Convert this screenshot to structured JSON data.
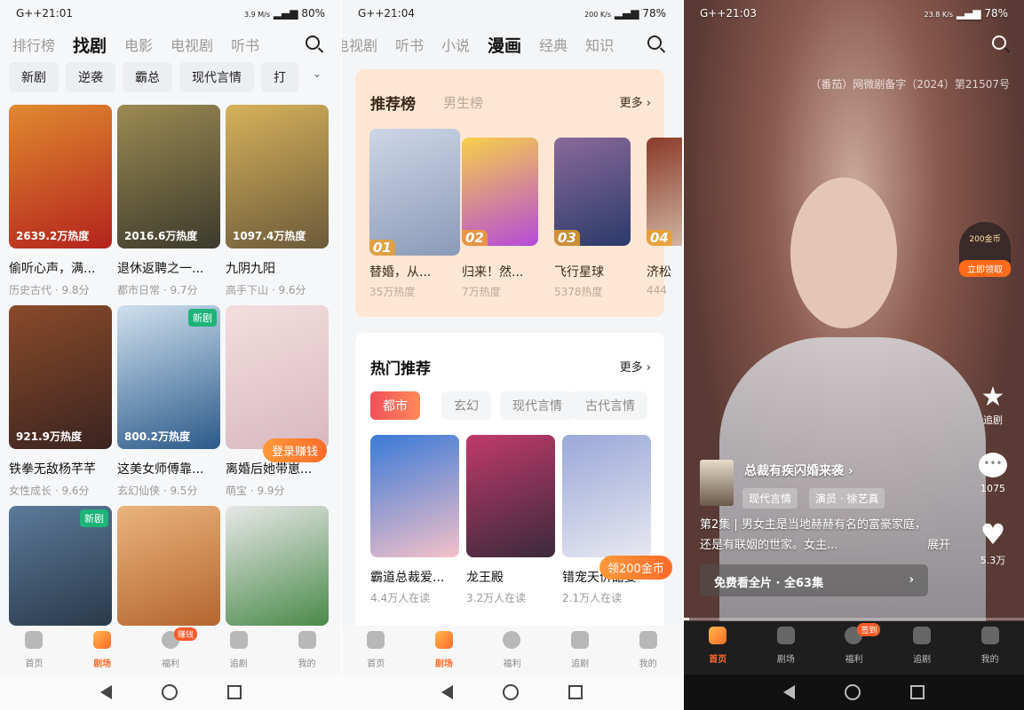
{
  "panel1": {
    "status": {
      "left": "G++21:01",
      "speed": "3.9 M/s",
      "battery": "80%"
    },
    "tabs": [
      "排行榜",
      "找剧",
      "电影",
      "电视剧",
      "听书"
    ],
    "active_tab": "找剧",
    "chips": [
      "新剧",
      "逆袭",
      "霸总",
      "现代言情",
      "打"
    ],
    "cards": [
      {
        "title": "偷听心声，满...",
        "meta": "历史古代 · 9.8分",
        "heat": "2639.2万热度",
        "colors": [
          "#b3231d",
          "#e0892f"
        ]
      },
      {
        "title": "退休返聘之一...",
        "meta": "都市日常 · 9.7分",
        "heat": "2016.6万热度",
        "colors": [
          "#3b3a2c",
          "#9c8a52"
        ]
      },
      {
        "title": "九阴九阳",
        "meta": "高手下山 · 9.6分",
        "heat": "1097.4万热度",
        "colors": [
          "#6b5a3a",
          "#d6b25a"
        ]
      },
      {
        "title": "铁拳无敌杨芊芊",
        "meta": "女性成长 · 9.6分",
        "heat": "921.9万热度",
        "colors": [
          "#3a2420",
          "#8a4a2a"
        ]
      },
      {
        "title": "这美女师傅靠...",
        "meta": "玄幻仙侠 · 9.5分",
        "heat": "800.2万热度",
        "new": "新剧",
        "colors": [
          "#2b5a8a",
          "#cfe0ee"
        ]
      },
      {
        "title": "离婚后她带崽...",
        "meta": "萌宝 · 9.9分",
        "heat": "",
        "colors": [
          "#d8b8c0",
          "#f3dede"
        ]
      },
      {
        "title": "",
        "meta": "",
        "heat": "",
        "new": "新剧",
        "colors": [
          "#2a3a4a",
          "#5c7a9a"
        ]
      },
      {
        "title": "",
        "meta": "",
        "heat": "",
        "colors": [
          "#b5652e",
          "#e9b47c"
        ]
      },
      {
        "title": "",
        "meta": "",
        "heat": "",
        "colors": [
          "#4a8a4a",
          "#e8e8e8"
        ]
      }
    ],
    "float_badge": "登录赚钱",
    "nav": [
      {
        "label": "首页"
      },
      {
        "label": "剧场",
        "active": true
      },
      {
        "label": "福利",
        "badge": "赚钱"
      },
      {
        "label": "追剧"
      },
      {
        "label": "我的"
      }
    ]
  },
  "panel2": {
    "status": {
      "left": "G++21:04",
      "speed": "200 K/s",
      "battery": "78%"
    },
    "tabs": [
      "电视剧",
      "听书",
      "小说",
      "漫画",
      "经典",
      "知识"
    ],
    "active_tab": "漫画",
    "rank_card": {
      "tabs": [
        "推荐榜",
        "男生榜"
      ],
      "more": "更多 ›",
      "items": [
        {
          "rank": "01",
          "title": "替婚，从...",
          "heat": "35万热度",
          "colors": [
            "#cdd6e6",
            "#8a9ab8"
          ]
        },
        {
          "rank": "02",
          "title": "归来！然...",
          "heat": "7万热度",
          "colors": [
            "#f7d04a",
            "#b54ad8"
          ]
        },
        {
          "rank": "03",
          "title": "飞行星球",
          "heat": "5378热度",
          "colors": [
            "#8a6a9a",
            "#2a3a6a"
          ]
        },
        {
          "rank": "04",
          "title": "济松",
          "heat": "444",
          "colors": [
            "#8a3a2a",
            "#d9c3b0"
          ]
        }
      ]
    },
    "hot": {
      "title": "热门推荐",
      "more": "更多 ›",
      "chips": [
        "都市",
        "玄幻",
        "现代言情",
        "古代言情"
      ],
      "items": [
        {
          "title": "霸道总裁爱...",
          "readers": "4.4万人在读",
          "colors": [
            "#3a7ad8",
            "#f3c0c8"
          ]
        },
        {
          "title": "龙王殿",
          "readers": "3.2万人在读",
          "colors": [
            "#c03a6a",
            "#3a2a3a"
          ]
        },
        {
          "title": "错宠天价甜妻",
          "readers": "2.1万人在读",
          "colors": [
            "#9aa8d8",
            "#e8e8f0"
          ]
        }
      ]
    },
    "float_badge": "领200金币",
    "nav": [
      {
        "label": "首页"
      },
      {
        "label": "剧场",
        "active": true
      },
      {
        "label": "福利"
      },
      {
        "label": "追剧"
      },
      {
        "label": "我的"
      }
    ]
  },
  "panel3": {
    "status": {
      "left": "G++21:03",
      "speed": "23.8 K/s",
      "battery": "78%"
    },
    "license": "（番茄）网微剧备字（2024）第21507号",
    "reward": {
      "coins": "200金币",
      "action": "立即领取"
    },
    "actions": {
      "follow": "追剧",
      "comments": "1075",
      "likes": "5.3万"
    },
    "show": {
      "title": "总裁有疾闪婚来袭 ›",
      "tags": [
        "现代言情",
        "演员 · 徐艺真"
      ],
      "desc": "第2集 | 男女主是当地赫赫有名的富豪家庭，还是有联姻的世家。女主...",
      "expand": "展开",
      "watch": "免费看全片 · 全63集"
    },
    "nav": [
      {
        "label": "首页",
        "active": true
      },
      {
        "label": "剧场"
      },
      {
        "label": "福利",
        "badge": "签到"
      },
      {
        "label": "追剧"
      },
      {
        "label": "我的"
      }
    ]
  },
  "colors": {
    "accent": "#ff6a2a",
    "peach": "#fde6d3",
    "chip_active": "#f0505a"
  }
}
